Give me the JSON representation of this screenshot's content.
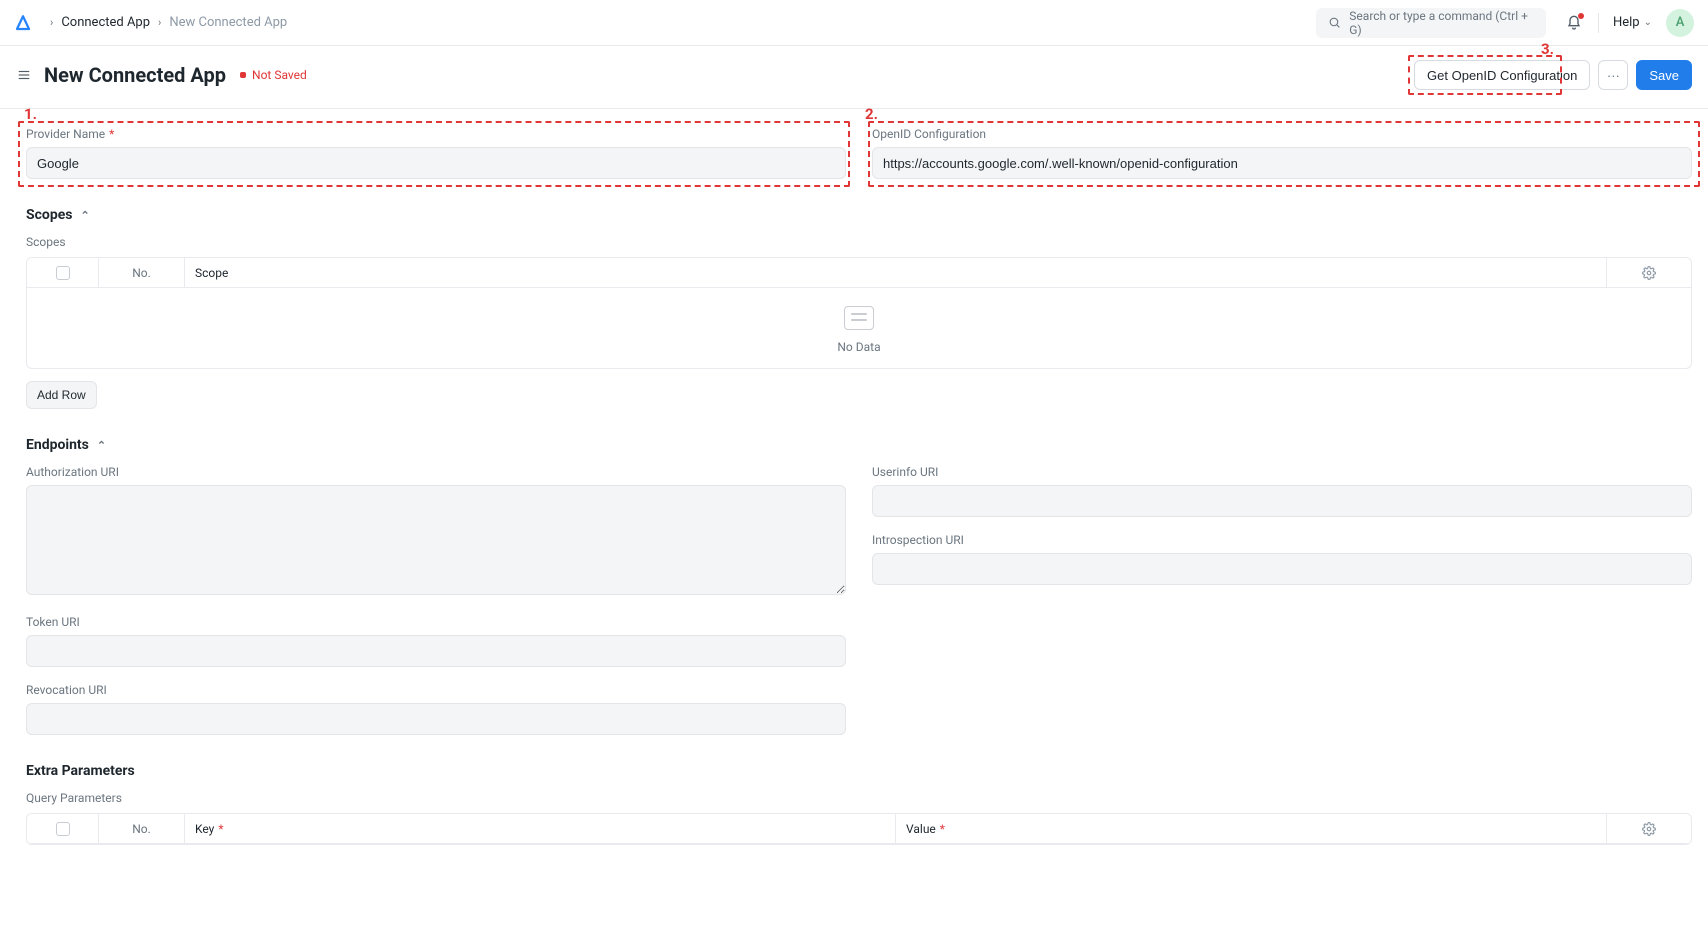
{
  "topnav": {
    "breadcrumb_parent": "Connected App",
    "breadcrumb_current": "New Connected App",
    "search_placeholder": "Search or type a command (Ctrl + G)",
    "help_label": "Help",
    "avatar_initial": "A"
  },
  "page": {
    "title": "New Connected App",
    "not_saved": "Not Saved",
    "get_openid_btn": "Get OpenID Configuration",
    "save_btn": "Save"
  },
  "fields": {
    "provider_name_label": "Provider Name",
    "provider_name_value": "Google",
    "openid_label": "OpenID Configuration",
    "openid_value": "https://accounts.google.com/.well-known/openid-configuration"
  },
  "scopes": {
    "section_title": "Scopes",
    "list_label": "Scopes",
    "col_no": "No.",
    "col_scope": "Scope",
    "no_data": "No Data",
    "add_row": "Add Row"
  },
  "endpoints": {
    "section_title": "Endpoints",
    "authorization_uri": "Authorization URI",
    "token_uri": "Token URI",
    "revocation_uri": "Revocation URI",
    "userinfo_uri": "Userinfo URI",
    "introspection_uri": "Introspection URI"
  },
  "extra": {
    "section_title": "Extra Parameters",
    "query_params_label": "Query Parameters",
    "col_no": "No.",
    "col_key": "Key",
    "col_value": "Value"
  },
  "annotations": {
    "one": "1.",
    "two": "2.",
    "three": "3."
  }
}
